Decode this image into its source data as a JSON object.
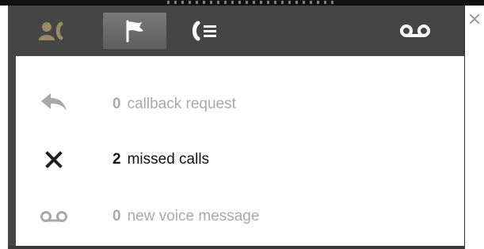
{
  "tabs": [
    {
      "id": "contacts",
      "icon": "contacts-icon",
      "active": false
    },
    {
      "id": "notifications",
      "icon": "flag-icon",
      "active": true
    },
    {
      "id": "call-log",
      "icon": "call-log-icon",
      "active": false
    },
    {
      "id": "voicemail",
      "icon": "voicemail-icon",
      "active": false
    }
  ],
  "notifications": {
    "callback": {
      "count": "0",
      "label": "callback request",
      "icon": "reply-arrow-icon"
    },
    "missed": {
      "count": "2",
      "label": "missed calls",
      "icon": "missed-call-x-icon"
    },
    "voicemail": {
      "count": "0",
      "label": "new voice message",
      "icon": "voicemail-icon"
    }
  },
  "colors": {
    "panel_bg": "#454545",
    "tab_active_bg": "#6b6b6b",
    "text_active": "#111111",
    "text_muted": "#a9a9a9",
    "icon_light": "#ffffff",
    "icon_muted": "#a0a0a0"
  }
}
